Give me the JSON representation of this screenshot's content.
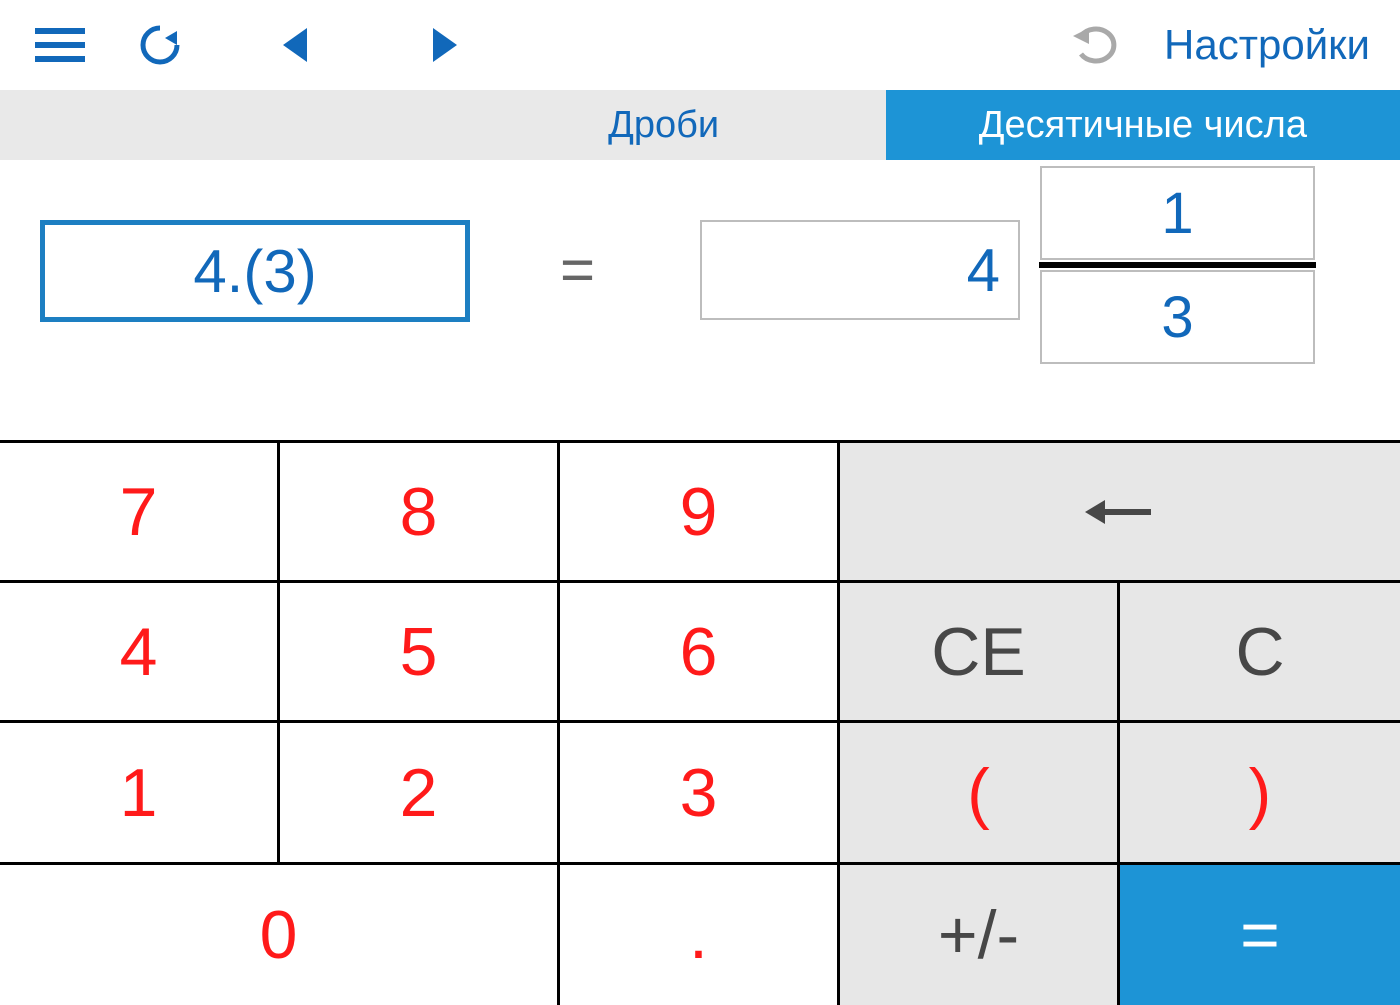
{
  "toolbar": {
    "settings_label": "Настройки"
  },
  "tabs": {
    "fractions_label": "Дроби",
    "decimals_label": "Десятичные числа",
    "active": "decimals"
  },
  "expression": {
    "decimal_input": "4.(3)",
    "equals": "=",
    "whole": "4",
    "numerator": "1",
    "denominator": "3"
  },
  "keypad": {
    "d7": "7",
    "d8": "8",
    "d9": "9",
    "d4": "4",
    "d5": "5",
    "d6": "6",
    "d1": "1",
    "d2": "2",
    "d3": "3",
    "d0": "0",
    "dot": ".",
    "ce": "CE",
    "c": "C",
    "lparen": "(",
    "rparen": ")",
    "plusminus": "+/-",
    "eq": "="
  }
}
